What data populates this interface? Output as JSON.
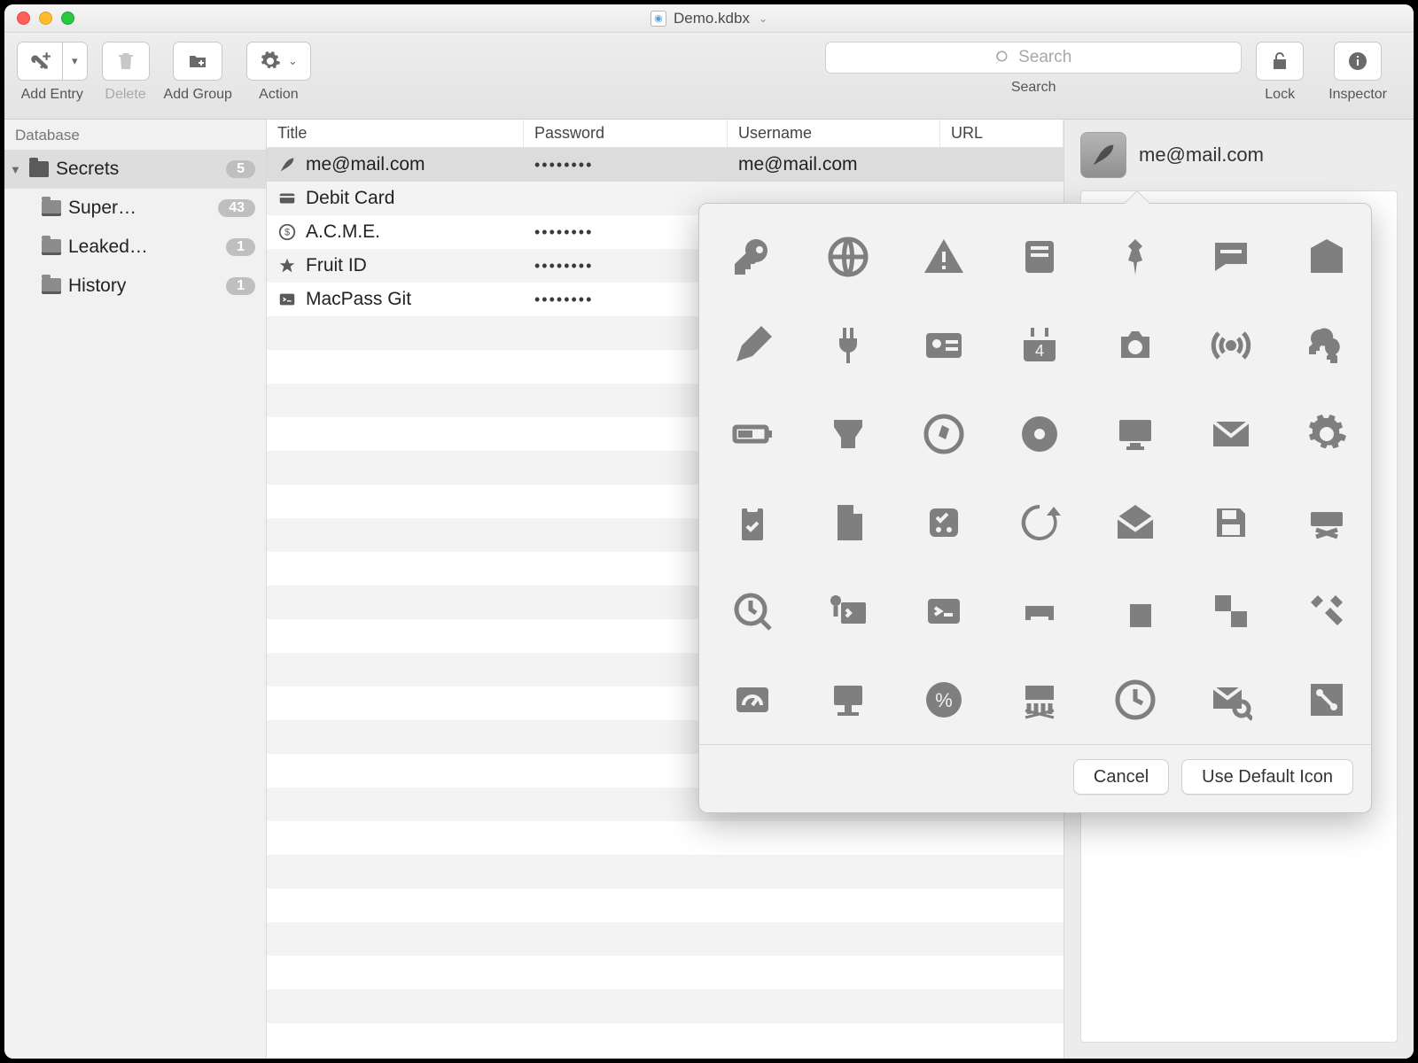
{
  "window": {
    "title": "Demo.kdbx"
  },
  "toolbar": {
    "add_entry": "Add Entry",
    "delete": "Delete",
    "add_group": "Add Group",
    "action": "Action",
    "search_label": "Search",
    "search_placeholder": "Search",
    "lock": "Lock",
    "inspector": "Inspector"
  },
  "sidebar": {
    "heading": "Database",
    "root": {
      "label": "Secrets",
      "count": "5"
    },
    "children": [
      {
        "label": "Super…",
        "count": "43"
      },
      {
        "label": "Leaked…",
        "count": "1"
      },
      {
        "label": "History",
        "count": "1"
      }
    ]
  },
  "table": {
    "columns": {
      "title": "Title",
      "password": "Password",
      "username": "Username",
      "url": "URL"
    },
    "rows": [
      {
        "icon": "feather",
        "title": "me@mail.com",
        "password": "••••••••",
        "username": "me@mail.com",
        "url": "",
        "selected": true
      },
      {
        "icon": "card",
        "title": "Debit Card",
        "password": "",
        "username": "",
        "url": ""
      },
      {
        "icon": "dollar",
        "title": "A.C.M.E.",
        "password": "••••••••",
        "username": "",
        "url": ""
      },
      {
        "icon": "star",
        "title": "Fruit ID",
        "password": "••••••••",
        "username": "",
        "url": ""
      },
      {
        "icon": "terminal",
        "title": "MacPass Git",
        "password": "••••••••",
        "username": "",
        "url": ""
      }
    ]
  },
  "inspector_panel": {
    "title": "me@mail.com"
  },
  "popover": {
    "cancel": "Cancel",
    "use_default": "Use Default Icon",
    "icons": [
      "key",
      "globe",
      "warning",
      "server",
      "pin",
      "chat",
      "building",
      "pencil",
      "plug",
      "id-card",
      "calendar",
      "camera",
      "broadcast",
      "keys",
      "battery",
      "scanner",
      "compass",
      "disc",
      "monitor",
      "mail",
      "gear",
      "clipboard",
      "document",
      "package",
      "refresh",
      "envelope-open",
      "floppy",
      "drive-remove",
      "clock-search",
      "key-terminal",
      "terminal",
      "printer",
      "layout",
      "checker",
      "tools",
      "dashboard",
      "display-stand",
      "percent",
      "shred",
      "clock",
      "mail-search",
      "node"
    ]
  }
}
